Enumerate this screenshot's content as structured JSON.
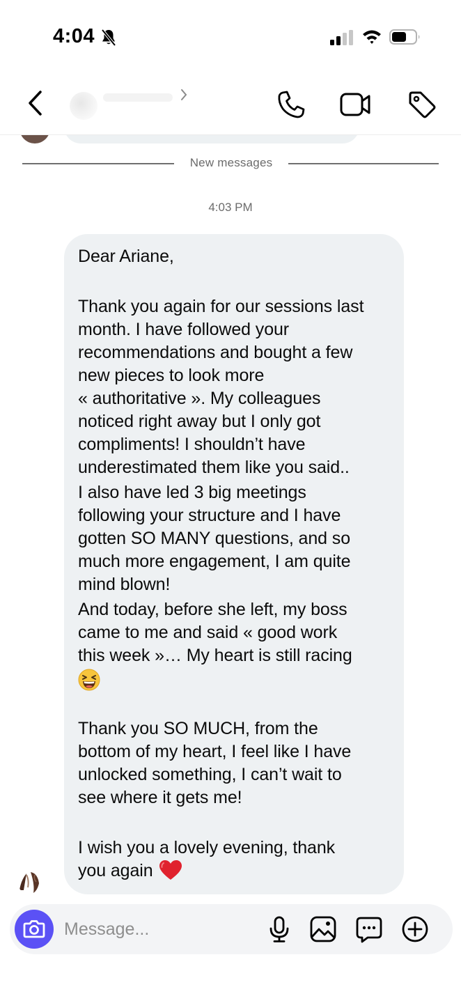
{
  "status_bar": {
    "time": "4:04",
    "icons": [
      "bell-slash-icon",
      "signal-icon",
      "wifi-icon",
      "battery-icon"
    ]
  },
  "header": {
    "icons": [
      "back-chevron-icon",
      "phone-icon",
      "video-camera-icon",
      "tag-icon"
    ]
  },
  "thread": {
    "divider_label": "New messages",
    "timestamp": "4:03 PM",
    "message_lines": [
      "Dear Ariane,",
      "",
      "Thank you again for our sessions last",
      "month. I have followed your",
      "recommendations and bought a few",
      "new pieces to look more",
      "« authoritative ». My colleagues",
      "noticed right away but I only got",
      "compliments! I shouldn’t have",
      "underestimated them like you said..",
      "I also have led 3 big meetings",
      "following your structure and I have",
      "gotten SO MANY questions, and so",
      "much more engagement, I am quite",
      "mind blown!",
      "And today, before she left, my boss",
      "came to me and said « good work",
      "this week »… My heart is still racing",
      "",
      "Thank you SO MUCH, from the",
      "bottom of my heart, I feel like I have",
      "unlocked something, I can’t wait to",
      "see where it gets me!",
      "",
      "I wish you a lovely evening, thank",
      "you again"
    ],
    "emojis": [
      "grinning-squinting-face-emoji",
      "red-heart-emoji"
    ]
  },
  "composer": {
    "placeholder": "Message...",
    "icons": [
      "camera-icon",
      "microphone-icon",
      "gallery-icon",
      "sticker-icon",
      "plus-circle-icon"
    ],
    "accent_color": "#5b51f5"
  }
}
